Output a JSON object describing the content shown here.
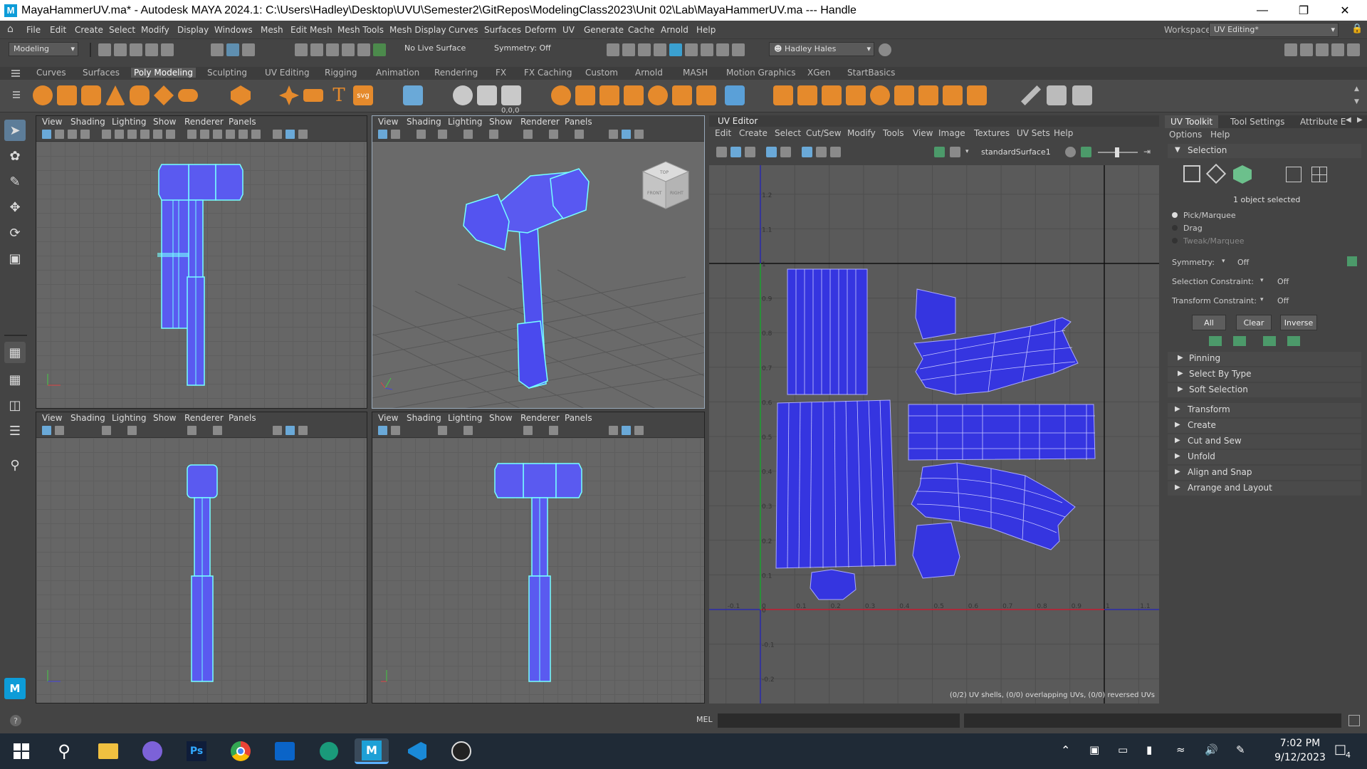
{
  "title_bar": {
    "app_icon": "M",
    "text": "MayaHammerUV.ma* - Autodesk MAYA 2024.1: C:\\Users\\Hadley\\Desktop\\UVU\\Semester2\\GitRepos\\ModelingClass2023\\Unit 02\\Lab\\MayaHammerUV.ma   ---   Handle",
    "minimize_icon": "minimize-icon",
    "restore_icon": "restore-icon",
    "close_icon": "close-icon"
  },
  "menubar": {
    "items": [
      "File",
      "Edit",
      "Create",
      "Select",
      "Modify",
      "Display",
      "Windows",
      "Mesh",
      "Edit Mesh",
      "Mesh Tools",
      "Mesh Display",
      "Curves",
      "Surfaces",
      "Deform",
      "UV",
      "Generate",
      "Cache",
      "Arnold",
      "Help"
    ],
    "workspace_label": "Workspace:",
    "workspace_value": "UV Editing*"
  },
  "status_line": {
    "menu_set": "Modeling",
    "live_surface": "No Live Surface",
    "symmetry": "Symmetry: Off",
    "user": "Hadley Hales"
  },
  "shelf": {
    "tabs": [
      "Curves",
      "Surfaces",
      "Poly Modeling",
      "Sculpting",
      "UV Editing",
      "Rigging",
      "Animation",
      "Rendering",
      "FX",
      "FX Caching",
      "Custom",
      "Arnold",
      "MASH",
      "Motion Graphics",
      "XGen",
      "StartBasics"
    ],
    "active_tab": "Poly Modeling",
    "coord_readout": "0,0,0"
  },
  "panel_menu": [
    "View",
    "Shading",
    "Lighting",
    "Show",
    "Renderer",
    "Panels"
  ],
  "viewcube": {
    "top": "TOP",
    "front": "FRONT",
    "right": "RIGHT"
  },
  "uv_editor": {
    "title": "UV Editor",
    "menu": [
      "Edit",
      "Create",
      "Select",
      "Cut/Sew",
      "Modify",
      "Tools",
      "View",
      "Image",
      "Textures",
      "UV Sets",
      "Help"
    ],
    "shader": "standardSurface1",
    "status": "(0/2) UV shells, (0/0) overlapping UVs, (0/0) reversed UVs",
    "u_ticks": [
      "-0.1",
      "0",
      "0.1",
      "0.2",
      "0.3",
      "0.4",
      "0.5",
      "0.6",
      "0.7",
      "0.8",
      "0.9",
      "1",
      "1.1"
    ],
    "v_ticks": [
      "1.2",
      "1.1",
      "1",
      "0.9",
      "0.8",
      "0.7",
      "0.6",
      "0.5",
      "0.4",
      "0.3",
      "0.2",
      "0.1",
      "0",
      "-0.1",
      "-0.2"
    ],
    "shell_color": "#3535e0"
  },
  "uv_toolkit": {
    "tabs": [
      "UV Toolkit",
      "Tool Settings",
      "Attribute E"
    ],
    "menu": [
      "Options",
      "Help"
    ],
    "selection_header": "Selection",
    "selected_count": "1 object selected",
    "modes": [
      "Pick/Marquee",
      "Drag",
      "Tweak/Marquee"
    ],
    "symmetry_label": "Symmetry:",
    "symmetry_value": "Off",
    "sel_constraint_label": "Selection Constraint:",
    "sel_constraint_value": "Off",
    "xform_constraint_label": "Transform Constraint:",
    "xform_constraint_value": "Off",
    "buttons": [
      "All",
      "Clear",
      "Inverse"
    ],
    "subsections": [
      "Pinning",
      "Select By Type",
      "Soft Selection"
    ],
    "sections": [
      "Transform",
      "Create",
      "Cut and Sew",
      "Unfold",
      "Align and Snap",
      "Arrange and Layout"
    ]
  },
  "command_line": {
    "help_icon": "?",
    "label": "MEL"
  },
  "taskbar": {
    "time": "7:02 PM",
    "date": "9/12/2023",
    "notification_count": "4",
    "apps": [
      "start-icon",
      "search-icon",
      "file-explorer-icon",
      "discord-icon",
      "photoshop-icon",
      "chrome-icon",
      "outlook-icon",
      "gitkraken-icon",
      "maya-icon",
      "vscode-icon",
      "obs-icon"
    ]
  }
}
